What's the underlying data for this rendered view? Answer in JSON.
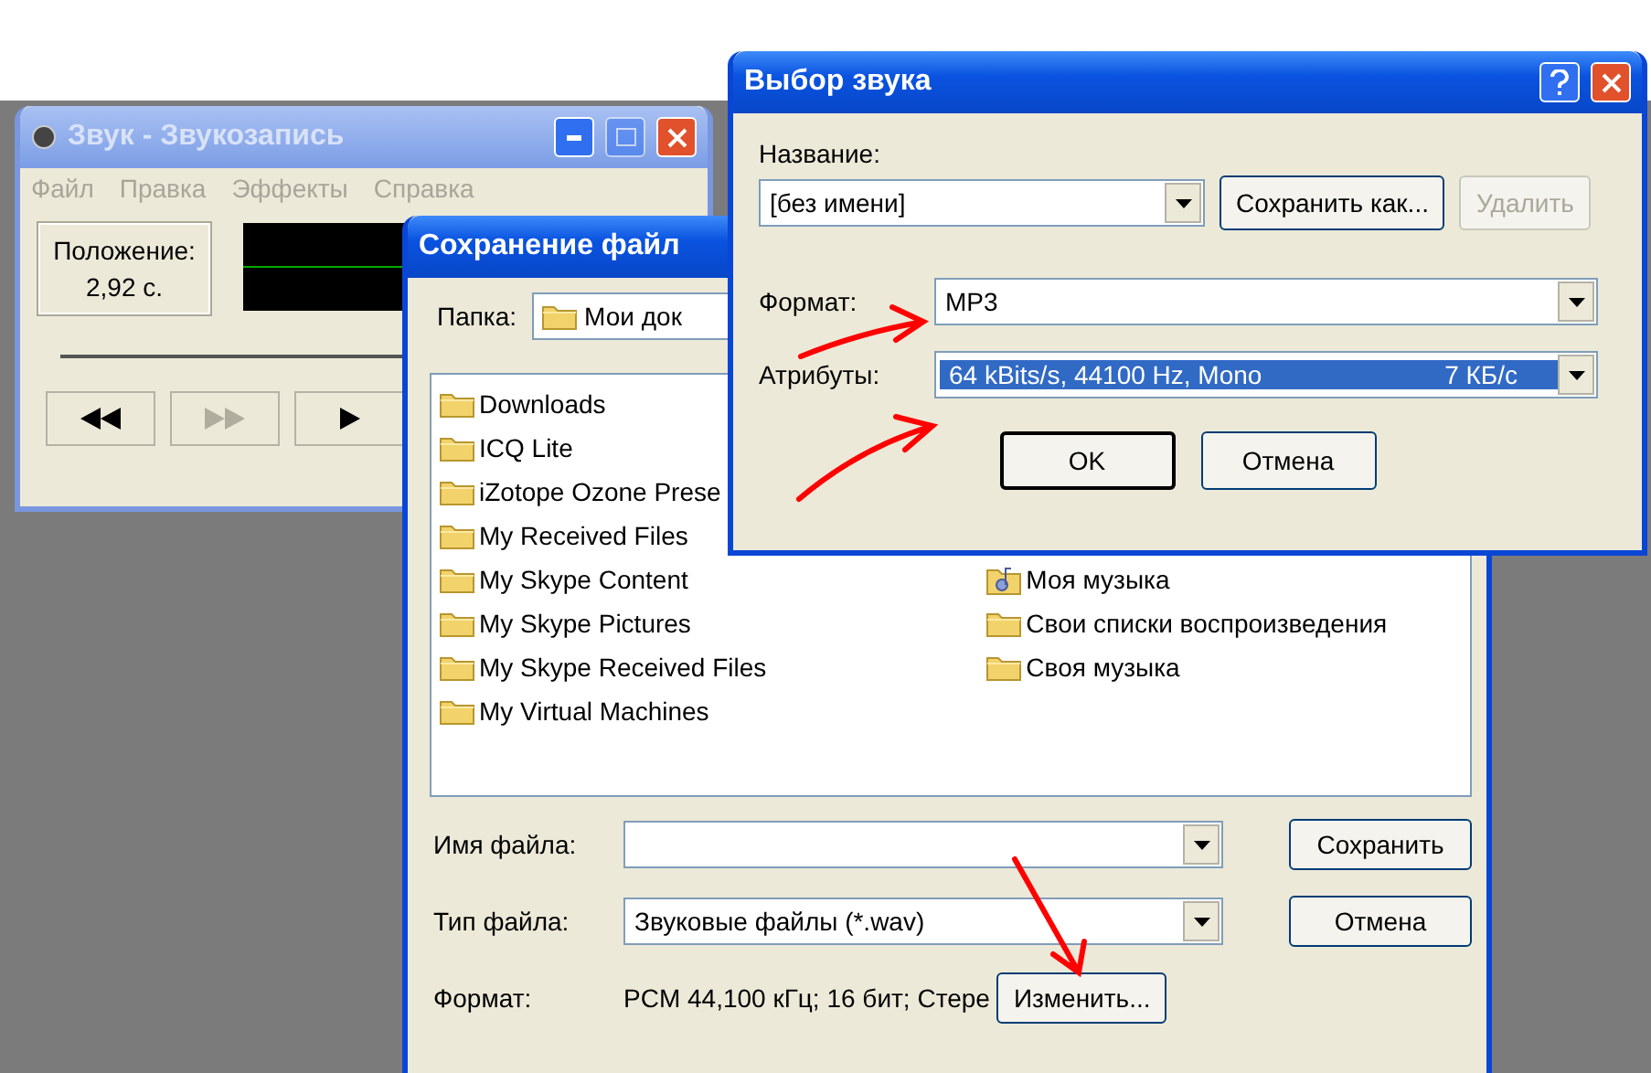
{
  "recorder": {
    "title": "Звук - Звукозапись",
    "active": false,
    "menu": [
      "Файл",
      "Правка",
      "Эффекты",
      "Справка"
    ],
    "position_label": "Положение:",
    "position_value": "2,92 с.",
    "transport": [
      {
        "kind": "rewind",
        "disabled": false
      },
      {
        "kind": "forward",
        "disabled": true
      },
      {
        "kind": "play",
        "disabled": false
      }
    ]
  },
  "save_dialog": {
    "title": "Сохранение файл",
    "folder_label": "Папка:",
    "folder_value": "Мои док",
    "files_left": [
      {
        "name": "Downloads",
        "kind": "folder"
      },
      {
        "name": "ICQ Lite",
        "kind": "folder"
      },
      {
        "name": "iZotope Ozone Prese",
        "kind": "folder"
      },
      {
        "name": "My Received Files",
        "kind": "folder"
      },
      {
        "name": "My Skype Content",
        "kind": "folder"
      },
      {
        "name": "My Skype Pictures",
        "kind": "folder"
      },
      {
        "name": "My Skype Received Files",
        "kind": "folder"
      },
      {
        "name": "My Virtual Machines",
        "kind": "folder"
      }
    ],
    "files_right": [
      {
        "name": "Моя музыка",
        "kind": "music_folder"
      },
      {
        "name": "Свои списки воспроизведения",
        "kind": "folder"
      },
      {
        "name": "Своя музыка",
        "kind": "folder"
      }
    ],
    "filename_label": "Имя файла:",
    "filetype_label": "Тип файла:",
    "filetype_value": "Звуковые файлы (*.wav)",
    "format_label": "Формат:",
    "format_value": "PCM 44,100 кГц; 16 бит; Стере",
    "change_button": "Изменить...",
    "buttons": [
      "Сохранить",
      "Отмена"
    ]
  },
  "sound_dialog": {
    "title": "Выбор звука",
    "name_label": "Название:",
    "name_value": "[без имени]",
    "name_buttons": [
      {
        "label": "Сохранить как...",
        "disabled": false
      },
      {
        "label": "Удалить",
        "disabled": true
      }
    ],
    "format_label": "Формат:",
    "format_value": "MP3",
    "attributes_label": "Атрибуты:",
    "attributes_value": "64 kBits/s, 44100 Hz, Mono",
    "attributes_rate": "7 КБ/с",
    "attributes_selected": true,
    "buttons": [
      {
        "label": "OK",
        "default": true
      },
      {
        "label": "Отмена",
        "default": false
      }
    ]
  }
}
